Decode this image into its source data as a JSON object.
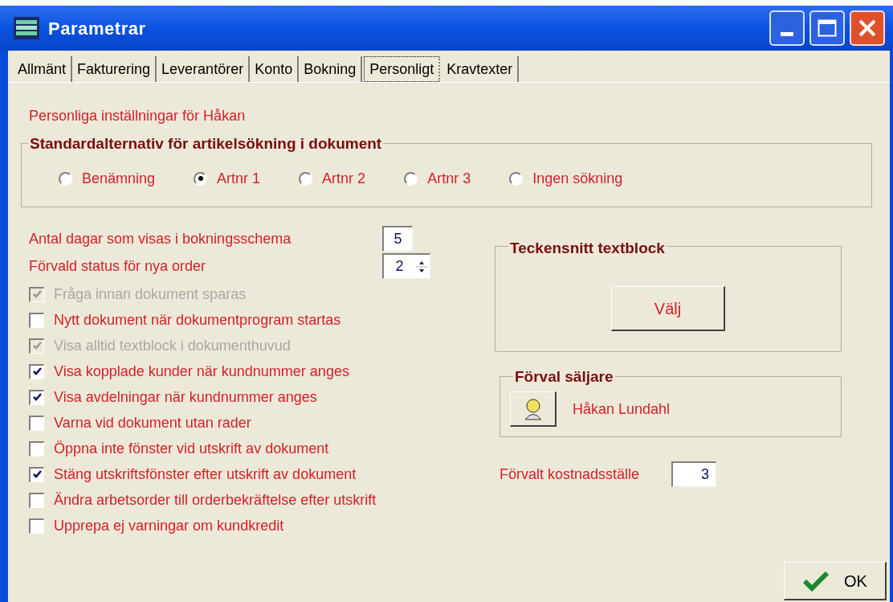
{
  "window": {
    "title": "Parametrar"
  },
  "tabs": [
    {
      "label": "Allmänt",
      "selected": false
    },
    {
      "label": "Fakturering",
      "selected": false
    },
    {
      "label": "Leverantörer",
      "selected": false
    },
    {
      "label": "Konto",
      "selected": false
    },
    {
      "label": "Bokning",
      "selected": false
    },
    {
      "label": "Personligt",
      "selected": true
    },
    {
      "label": "Kravtexter",
      "selected": false
    }
  ],
  "heading": "Personliga inställningar för Håkan",
  "search_group": {
    "title": "Standardalternativ för artikelsökning i dokument",
    "options": [
      {
        "label": "Benämning",
        "selected": false
      },
      {
        "label": "Artnr 1",
        "selected": true
      },
      {
        "label": "Artnr 2",
        "selected": false
      },
      {
        "label": "Artnr 3",
        "selected": false
      },
      {
        "label": "Ingen sökning",
        "selected": false
      }
    ]
  },
  "fields": [
    {
      "kind": "text",
      "label": "Antal dagar som visas i bokningsschema",
      "value": "5"
    },
    {
      "kind": "spinner",
      "label": "Förvald status för nya order",
      "value": "2"
    }
  ],
  "checkboxes": [
    {
      "label": "Fråga innan dokument sparas",
      "checked": true,
      "disabled": true
    },
    {
      "label": "Nytt dokument när dokumentprogram startas",
      "checked": false,
      "disabled": false
    },
    {
      "label": "Visa alltid textblock i dokumenthuvud",
      "checked": true,
      "disabled": true
    },
    {
      "label": "Visa kopplade kunder när kundnummer anges",
      "checked": true,
      "disabled": false
    },
    {
      "label": "Visa avdelningar när kundnummer anges",
      "checked": true,
      "disabled": false
    },
    {
      "label": "Varna vid dokument utan rader",
      "checked": false,
      "disabled": false
    },
    {
      "label": "Öppna inte fönster vid utskrift av dokument",
      "checked": false,
      "disabled": false
    },
    {
      "label": "Stäng utskriftsfönster efter utskrift av dokument",
      "checked": true,
      "disabled": false
    },
    {
      "label": "Ändra arbetsorder till orderbekräftelse efter utskrift",
      "checked": false,
      "disabled": false
    },
    {
      "label": "Upprepa ej varningar om kundkredit",
      "checked": false,
      "disabled": false
    }
  ],
  "font_group": {
    "title": "Teckensnitt textblock",
    "button": "Välj"
  },
  "seller_group": {
    "title": "Förval säljare",
    "name": "Håkan Lundahl"
  },
  "cost_center": {
    "label": "Förvalt kostnadsställe",
    "value": "3"
  },
  "ok_button": "OK"
}
